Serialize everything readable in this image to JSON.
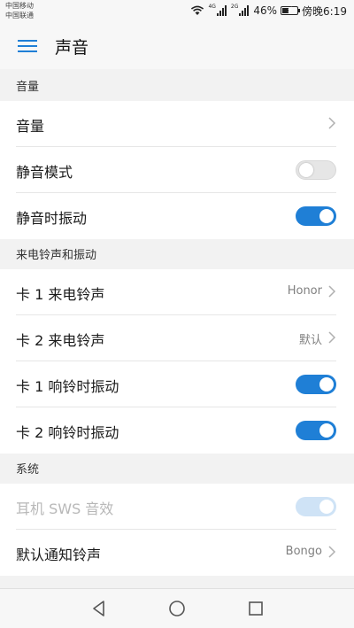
{
  "status_bar": {
    "carrier1": "中国移动",
    "carrier2": "中国联通",
    "signal1_label": "4G",
    "signal2_label": "2G",
    "battery_percent": "46%",
    "battery_level": 0.46,
    "time": "傍晚6:19"
  },
  "header": {
    "title": "声音"
  },
  "sections": {
    "volume": {
      "header": "音量",
      "items": [
        {
          "label": "音量",
          "control": "chevron"
        },
        {
          "label": "静音模式",
          "control": "toggle",
          "state": "off"
        },
        {
          "label": "静音时振动",
          "control": "toggle",
          "state": "on"
        }
      ]
    },
    "ringtone": {
      "header": "来电铃声和振动",
      "items": [
        {
          "label": "卡 1 来电铃声",
          "value": "Honor",
          "control": "chevron"
        },
        {
          "label": "卡 2 来电铃声",
          "value": "默认",
          "control": "chevron"
        },
        {
          "label": "卡 1 响铃时振动",
          "control": "toggle",
          "state": "on"
        },
        {
          "label": "卡 2 响铃时振动",
          "control": "toggle",
          "state": "on"
        }
      ]
    },
    "system": {
      "header": "系统",
      "items": [
        {
          "label": "耳机 SWS 音效",
          "control": "toggle",
          "state": "on",
          "disabled": true
        },
        {
          "label": "默认通知铃声",
          "value": "Bongo",
          "control": "chevron"
        }
      ]
    }
  },
  "colors": {
    "accent": "#1f7fd6",
    "toggle_off": "#e6e6e6",
    "toggle_disabled": "#cfe3f6"
  }
}
